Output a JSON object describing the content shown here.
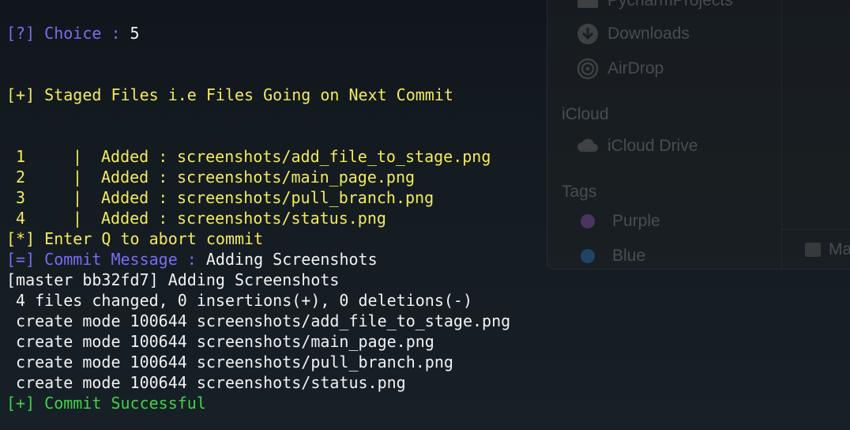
{
  "background_finder": {
    "sidebar_items": [
      {
        "label": "PycharmProjects",
        "icon": "folder-icon"
      },
      {
        "label": "Downloads",
        "icon": "download-icon"
      },
      {
        "label": "AirDrop",
        "icon": "airdrop-icon"
      }
    ],
    "icloud_header": "iCloud",
    "icloud_items": [
      {
        "label": "iCloud Drive",
        "icon": "cloud-icon"
      }
    ],
    "tags_header": "Tags",
    "tags": [
      {
        "label": "Purple",
        "color": "#7a4fa0"
      },
      {
        "label": "Blue",
        "color": "#2a74c7"
      }
    ],
    "status_label": "Ma"
  },
  "terminal": {
    "choice_prompt": "[?] Choice : ",
    "choice_value": "5",
    "staged_header": "[+] Staged Files i.e Files Going on Next Commit",
    "staged_files": [
      {
        "num": "1",
        "sep": "|",
        "status": "Added :",
        "path": "screenshots/add_file_to_stage.png"
      },
      {
        "num": "2",
        "sep": "|",
        "status": "Added :",
        "path": "screenshots/main_page.png"
      },
      {
        "num": "3",
        "sep": "|",
        "status": "Added :",
        "path": "screenshots/pull_branch.png"
      },
      {
        "num": "4",
        "sep": "|",
        "status": "Added :",
        "path": "screenshots/status.png"
      }
    ],
    "abort_hint": "[*] Enter Q to abort commit",
    "commit_prompt": "[=] Commit Message : ",
    "commit_message": "Adding Screenshots",
    "git_output": [
      "[master bb32fd7] Adding Screenshots",
      " 4 files changed, 0 insertions(+), 0 deletions(-)",
      " create mode 100644 screenshots/add_file_to_stage.png",
      " create mode 100644 screenshots/main_page.png",
      " create mode 100644 screenshots/pull_branch.png",
      " create mode 100644 screenshots/status.png"
    ],
    "success": "[+] Commit Successful",
    "colors": {
      "prompt": "#7a6cf2",
      "highlight": "#f3eb5b",
      "output": "#f2f2f2",
      "success": "#43d14b"
    }
  }
}
